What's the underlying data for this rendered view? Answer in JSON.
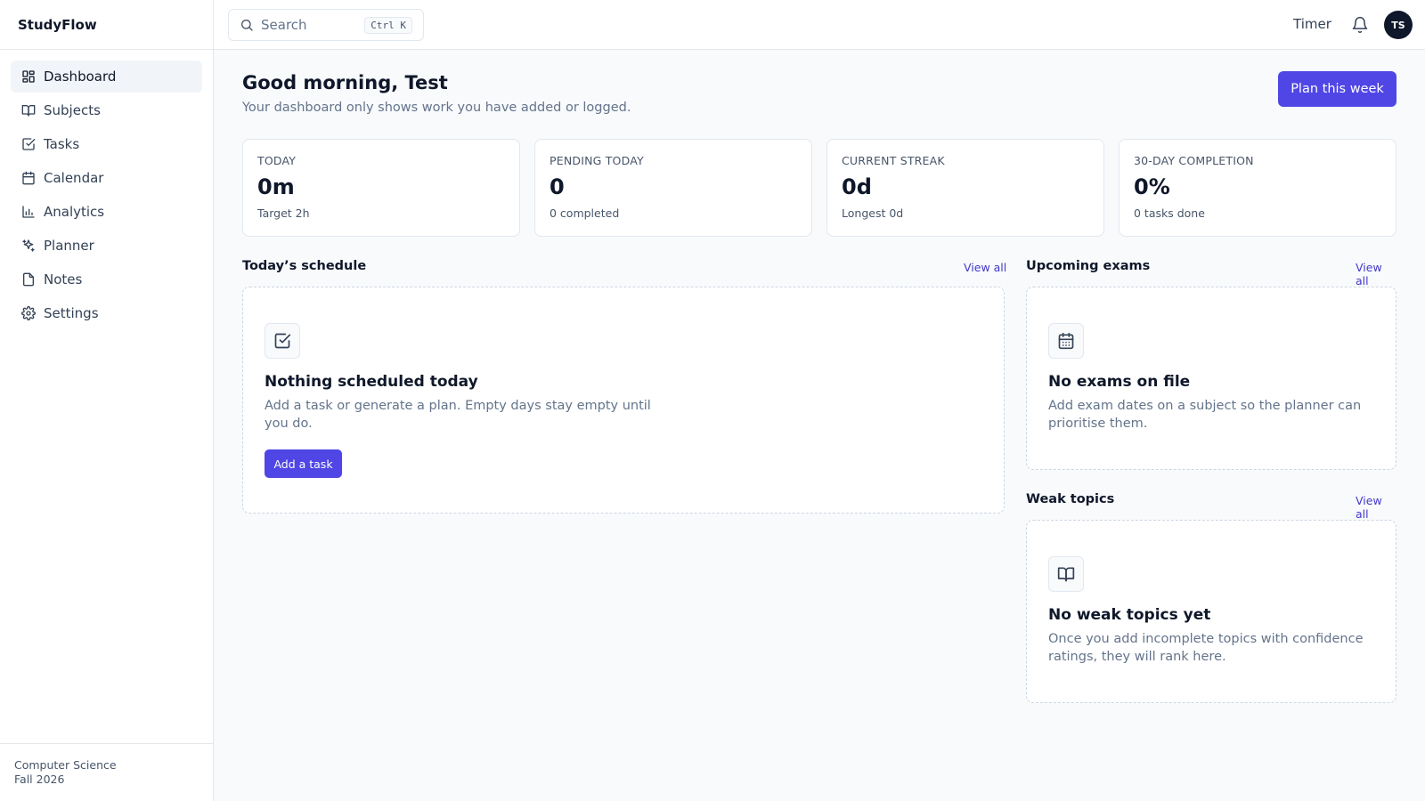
{
  "app": {
    "name": "StudyFlow"
  },
  "sidebar": {
    "items": [
      {
        "label": "Dashboard",
        "icon": "dashboard-icon",
        "active": true
      },
      {
        "label": "Subjects",
        "icon": "book-icon"
      },
      {
        "label": "Tasks",
        "icon": "check-square-icon"
      },
      {
        "label": "Calendar",
        "icon": "calendar-icon"
      },
      {
        "label": "Analytics",
        "icon": "bar-chart-icon"
      },
      {
        "label": "Planner",
        "icon": "sparkles-icon"
      },
      {
        "label": "Notes",
        "icon": "note-icon"
      },
      {
        "label": "Settings",
        "icon": "gear-icon"
      }
    ],
    "footer": {
      "program": "Computer Science",
      "term": "Fall 2026"
    }
  },
  "header": {
    "search_placeholder": "Search",
    "search_shortcut": "Ctrl K",
    "timer_label": "Timer",
    "avatar_initials": "TS"
  },
  "main": {
    "greeting": "Good morning, Test",
    "subtitle": "Your dashboard only shows work you have added or logged.",
    "plan_button": "Plan this week",
    "stats": [
      {
        "label": "TODAY",
        "value": "0m",
        "sub": "Target 2h"
      },
      {
        "label": "PENDING TODAY",
        "value": "0",
        "sub": "0 completed"
      },
      {
        "label": "CURRENT STREAK",
        "value": "0d",
        "sub": "Longest 0d"
      },
      {
        "label": "30-DAY COMPLETION",
        "value": "0%",
        "sub": "0 tasks done"
      }
    ],
    "schedule": {
      "title": "Today’s schedule",
      "view_all": "View all",
      "empty_title": "Nothing scheduled today",
      "empty_desc_line1": "Add a task or generate a plan. Empty days stay empty until",
      "empty_desc_line2": "you do.",
      "button": "Add a task"
    },
    "exams": {
      "title": "Upcoming exams",
      "view_all": "View all",
      "empty_title": "No exams on file",
      "empty_desc_line1": "Add exam dates on a subject so the planner can",
      "empty_desc_line2": "prioritise them."
    },
    "weak_topics": {
      "title": "Weak topics",
      "view_all": "View all",
      "empty_title": "No weak topics yet",
      "empty_desc_line1": "Once you add incomplete topics with confidence",
      "empty_desc_line2": "ratings, they will rank here."
    }
  },
  "colors": {
    "accent": "#4f46e5",
    "link": "#4338ca",
    "text": "#0f172a",
    "muted": "#64748b"
  }
}
